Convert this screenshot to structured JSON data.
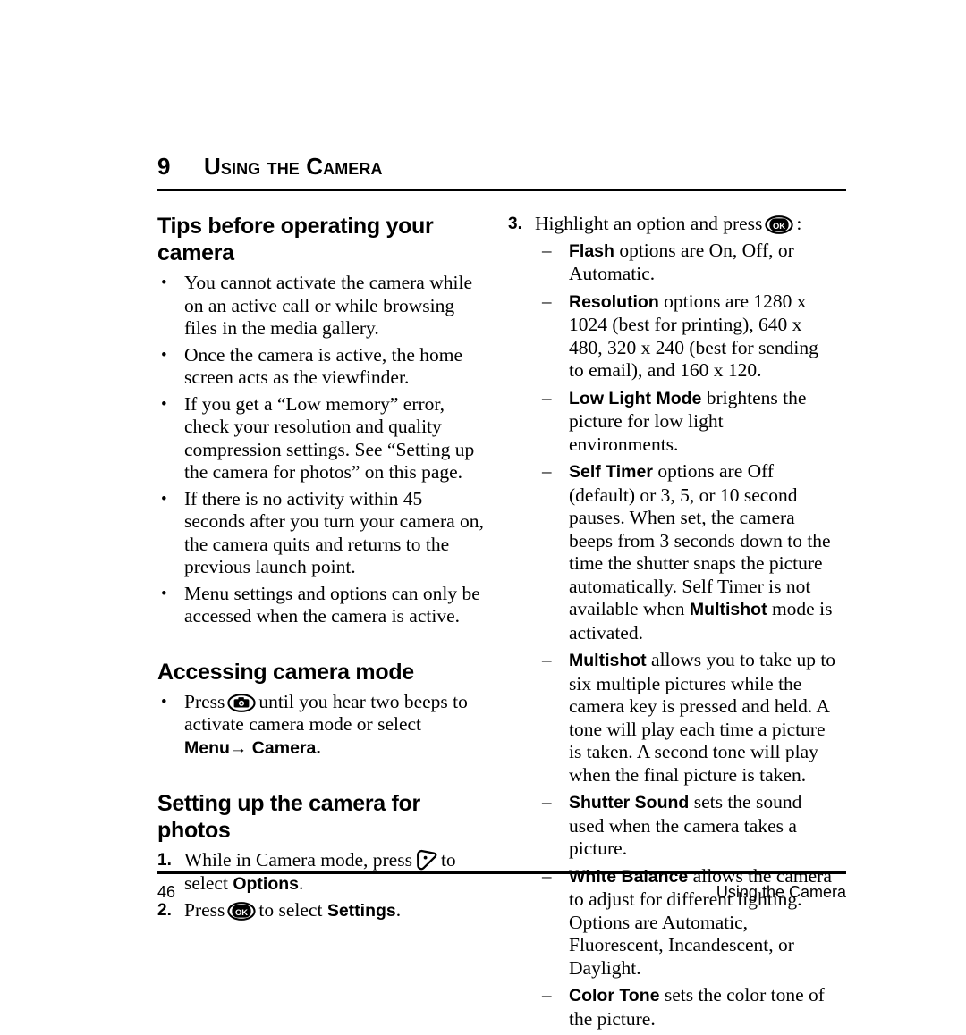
{
  "header": {
    "chapter_number": "9",
    "chapter_title": "Using the Camera"
  },
  "left_column": {
    "section1": {
      "heading": "Tips before operating your camera",
      "bullets": [
        "You cannot activate the camera while on an active call or while browsing files in the media gallery.",
        "Once the camera is active, the home screen acts as the viewfinder.",
        "If you get a “Low memory” error, check your resolution and quality compression settings. See “Setting up the camera for photos” on this page.",
        "If there is no activity within 45 seconds after you turn your camera on, the camera quits and returns to the previous launch point.",
        "Menu settings and options can only be accessed when the camera is active."
      ]
    },
    "section2": {
      "heading": "Accessing camera mode",
      "bullet_pre": "Press",
      "bullet_mid": "until you hear two beeps to activate camera mode or select",
      "bullet_bold_menu": "Menu",
      "bullet_arrow": "→",
      "bullet_bold_camera": "Camera",
      "bullet_end": "."
    },
    "section3": {
      "heading": "Setting up the camera for photos",
      "step1_marker": "1.",
      "step1_pre": "While in Camera mode, press",
      "step1_mid": "to select",
      "step1_bold": "Options",
      "step1_end": ".",
      "step2_marker": "2.",
      "step2_pre": "Press",
      "step2_mid": "to select",
      "step2_bold": "Settings",
      "step2_end": "."
    }
  },
  "right_column": {
    "step3_marker": "3.",
    "step3_pre": "Highlight an option and press",
    "step3_end": ":",
    "options": [
      {
        "name": "Flash",
        "text": "options are On, Off, or Automatic."
      },
      {
        "name": "Resolution",
        "text": "options are 1280 x 1024 (best for printing), 640 x 480, 320 x 240 (best for sending to email), and 160 x 120."
      },
      {
        "name": "Low Light Mode",
        "text": "brightens the picture for low light environments."
      },
      {
        "name": "Self Timer",
        "text": "options are Off (default) or 3, 5, or 10 second pauses. When set, the camera beeps from 3 seconds down to the time the shutter snaps the picture automatically. Self Timer is not available when ",
        "inline_bold": "Multishot",
        "text_after": " mode is activated."
      },
      {
        "name": "Multishot",
        "text": "allows you to take up to six multiple pictures while the camera key is pressed and held. A tone will play each time a picture is taken. A second tone will play when the final picture is taken."
      },
      {
        "name": "Shutter Sound",
        "text": "sets the sound used when the camera takes a picture."
      },
      {
        "name": "White Balance",
        "text": "allows the camera to adjust for different lighting. Options are Automatic, Fluorescent, Incandescent, or Daylight."
      },
      {
        "name": "Color Tone",
        "text": "sets the color tone of the picture."
      }
    ],
    "dash_marker": "–"
  },
  "footer": {
    "page_number": "46",
    "running_title": "Using the Camera"
  },
  "icons": {
    "camera_key": "camera-key-icon",
    "ok_key": "ok-key-icon",
    "nav_key": "navigation-key-icon",
    "ok_label": "OK"
  },
  "markers": {
    "bullet": "•"
  },
  "colors": {
    "text": "#000000",
    "background": "#ffffff",
    "rule": "#000000"
  }
}
